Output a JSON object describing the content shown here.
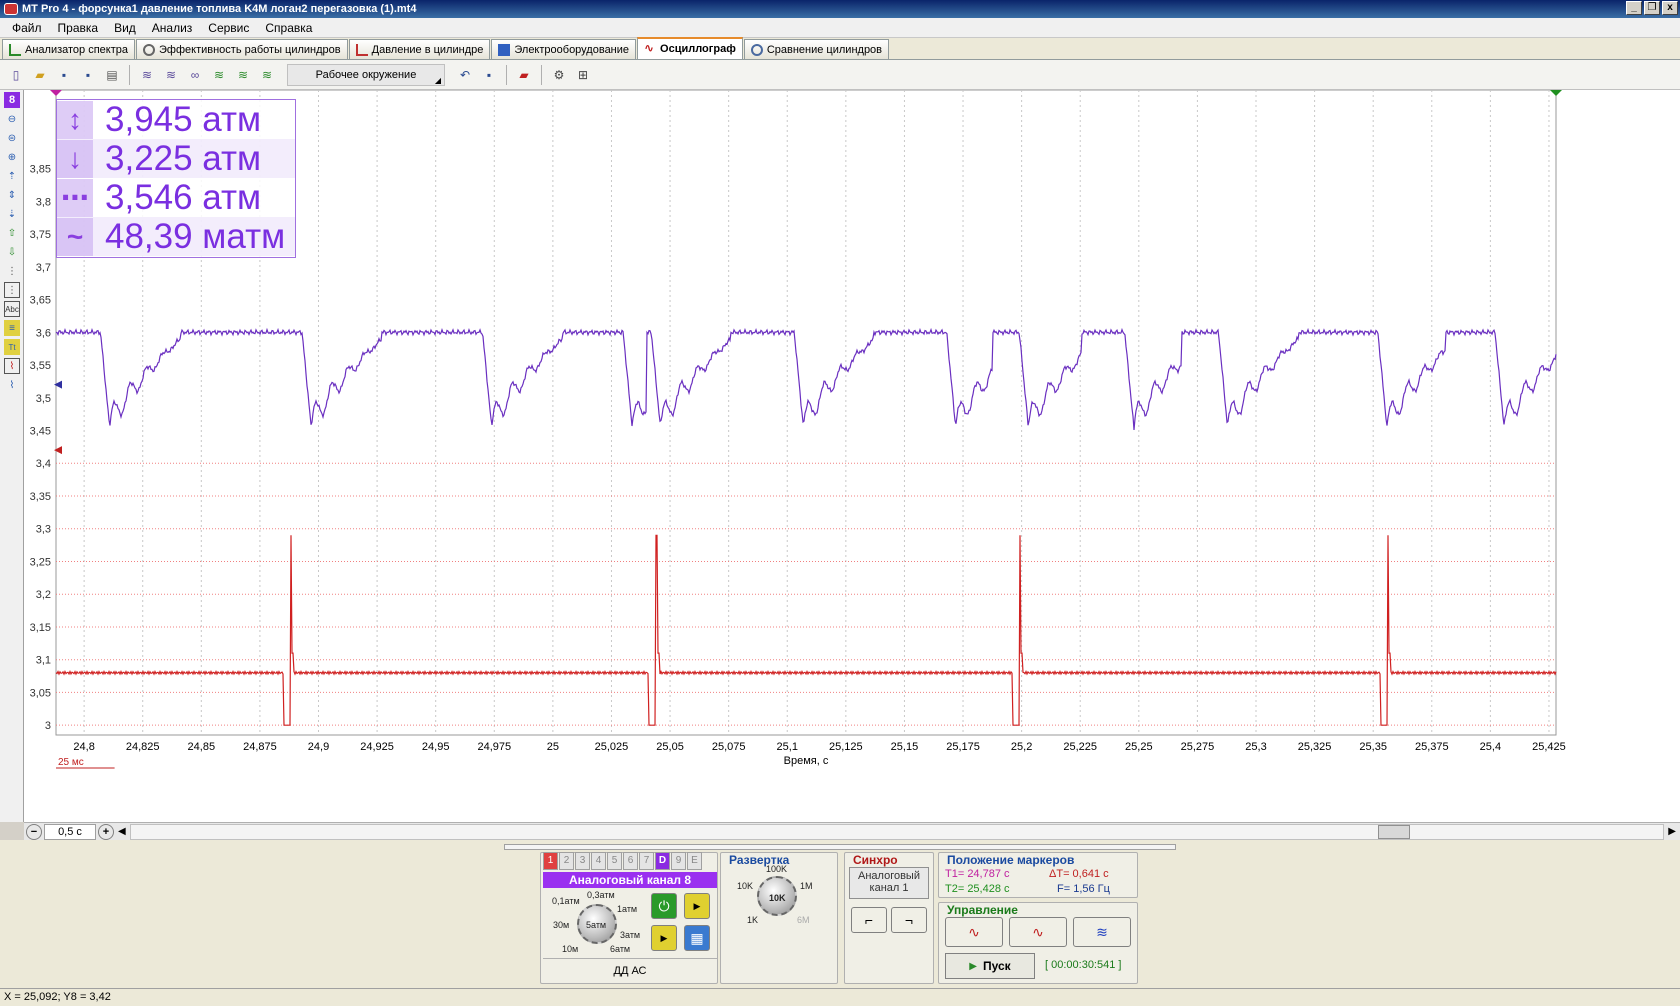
{
  "window": {
    "title": "MT Pro 4 - форсунка1 давление топлива K4M логан2 перегазовка (1).mt4",
    "controls": [
      "_",
      "❐",
      "x"
    ]
  },
  "menu": [
    "Файл",
    "Правка",
    "Вид",
    "Анализ",
    "Сервис",
    "Справка"
  ],
  "tabs": [
    {
      "label": "Анализатор спектра",
      "active": false
    },
    {
      "label": "Эффективность работы цилиндров",
      "active": false
    },
    {
      "label": "Давление в цилиндре",
      "active": false
    },
    {
      "label": "Электрооборудование",
      "active": false
    },
    {
      "label": "Осциллограф",
      "active": true
    },
    {
      "label": "Сравнение цилиндров",
      "active": false
    }
  ],
  "toolbar": {
    "environment_label": "Рабочее окружение"
  },
  "channel_badge": "8",
  "measurements": [
    {
      "icon": "max-arrow-icon",
      "value": "3,945 атм"
    },
    {
      "icon": "min-arrow-icon",
      "value": "3,225 атм"
    },
    {
      "icon": "average-icon",
      "value": "3,546 атм"
    },
    {
      "icon": "ripple-icon",
      "value": "48,39 матм"
    }
  ],
  "chart_data": {
    "type": "line",
    "xlabel": "Время, с",
    "xlim": [
      24.788,
      25.428
    ],
    "ylim": [
      2.985,
      3.97
    ],
    "x_ticks": [
      "24,8",
      "24,825",
      "24,85",
      "24,875",
      "24,9",
      "24,925",
      "24,95",
      "24,975",
      "25",
      "25,025",
      "25,05",
      "25,075",
      "25,1",
      "25,125",
      "25,15",
      "25,175",
      "25,2",
      "25,225",
      "25,25",
      "25,275",
      "25,3",
      "25,325",
      "25,35",
      "25,375",
      "25,4",
      "25,425"
    ],
    "y_ticks": [
      "3,85",
      "3,8",
      "3,75",
      "3,7",
      "3,65",
      "3,6",
      "3,55",
      "3,5",
      "3,45",
      "3,4",
      "3,35",
      "3,3",
      "3,25",
      "3,2",
      "3,15",
      "3,1",
      "3,05",
      "3"
    ],
    "scale_label": "25 мс",
    "grid": true,
    "series": [
      {
        "color": "#6a2fc0",
        "baseline": 3.54,
        "dip_times": [
          24.811,
          24.897,
          24.974,
          25.034,
          25.046,
          25.107,
          25.172,
          25.203,
          25.248,
          25.288,
          25.356,
          25.406
        ],
        "peak": 3.61,
        "trough": 3.46
      },
      {
        "color": "#d02020",
        "baseline": 3.08,
        "pulse_times": [
          24.888,
          25.044,
          25.199,
          25.356
        ],
        "spike": 3.29,
        "low": 3.0
      }
    ]
  },
  "scroll": {
    "zoom_value": "0,5 с"
  },
  "bottom": {
    "channel_tabs": [
      "1",
      "2",
      "3",
      "4",
      "5",
      "6",
      "7",
      "D",
      "9",
      "E"
    ],
    "channel_header": "Аналоговый канал 8",
    "range_labels": [
      "0,3атм",
      "0,1атм",
      "1атм",
      "30м",
      "5атм",
      "3атм",
      "10м",
      "6атм"
    ],
    "sensor_label": "ДД АС",
    "sweep_title": "Развертка",
    "sweep_labels": [
      "100K",
      "10K",
      "1M",
      "10K",
      "1K",
      "6M"
    ],
    "sync_title": "Синхро",
    "sync_source": "Аналоговый канал 1",
    "markers_title": "Положение маркеров",
    "t1": "T1= 24,787 с",
    "t2": "T2= 25,428 с",
    "dt": "ΔT= 0,641 с",
    "freq": "F= 1,56 Гц",
    "control_title": "Управление",
    "start_label": "Пуск",
    "elapsed": "[ 00:00:30:541 ]"
  },
  "status": "X = 25,092; Y8 = 3,42",
  "colors": {
    "purple": "#7a2fe0",
    "red": "#d02020",
    "grid": "#bbbbbb",
    "redgrid": "#f08080"
  }
}
